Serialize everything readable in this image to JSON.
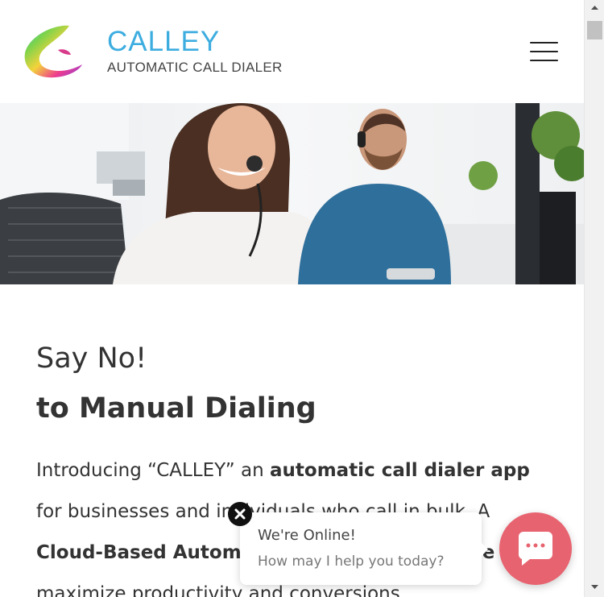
{
  "header": {
    "logo_title": "CALLEY",
    "logo_subtitle": "AUTOMATIC CALL DIALER",
    "menu_icon": "hamburger-menu-icon"
  },
  "hero": {
    "image": "call-center-agents-with-headsets"
  },
  "main": {
    "headline_line1": "Say No!",
    "headline_line2_prefix": "to ",
    "headline_line2_bold": "Manual Dialing",
    "intro_text_1": "Introducing “CALLEY” an ",
    "intro_bold_1": "automatic call dialer app",
    "intro_text_2": " for businesses and individuals who call in bulk. A ",
    "intro_bold_2": "Cloud-Based Automatic Call Dialer Software",
    "intro_text_3": " to maximize productivity and conversions."
  },
  "chat": {
    "title": "We're Online!",
    "subtitle": "How may I help you today?",
    "close_icon": "close-icon",
    "launcher_icon": "chat-icon",
    "launcher_color": "#e86370"
  },
  "colors": {
    "brand_blue": "#3dade0",
    "text": "#333333"
  }
}
